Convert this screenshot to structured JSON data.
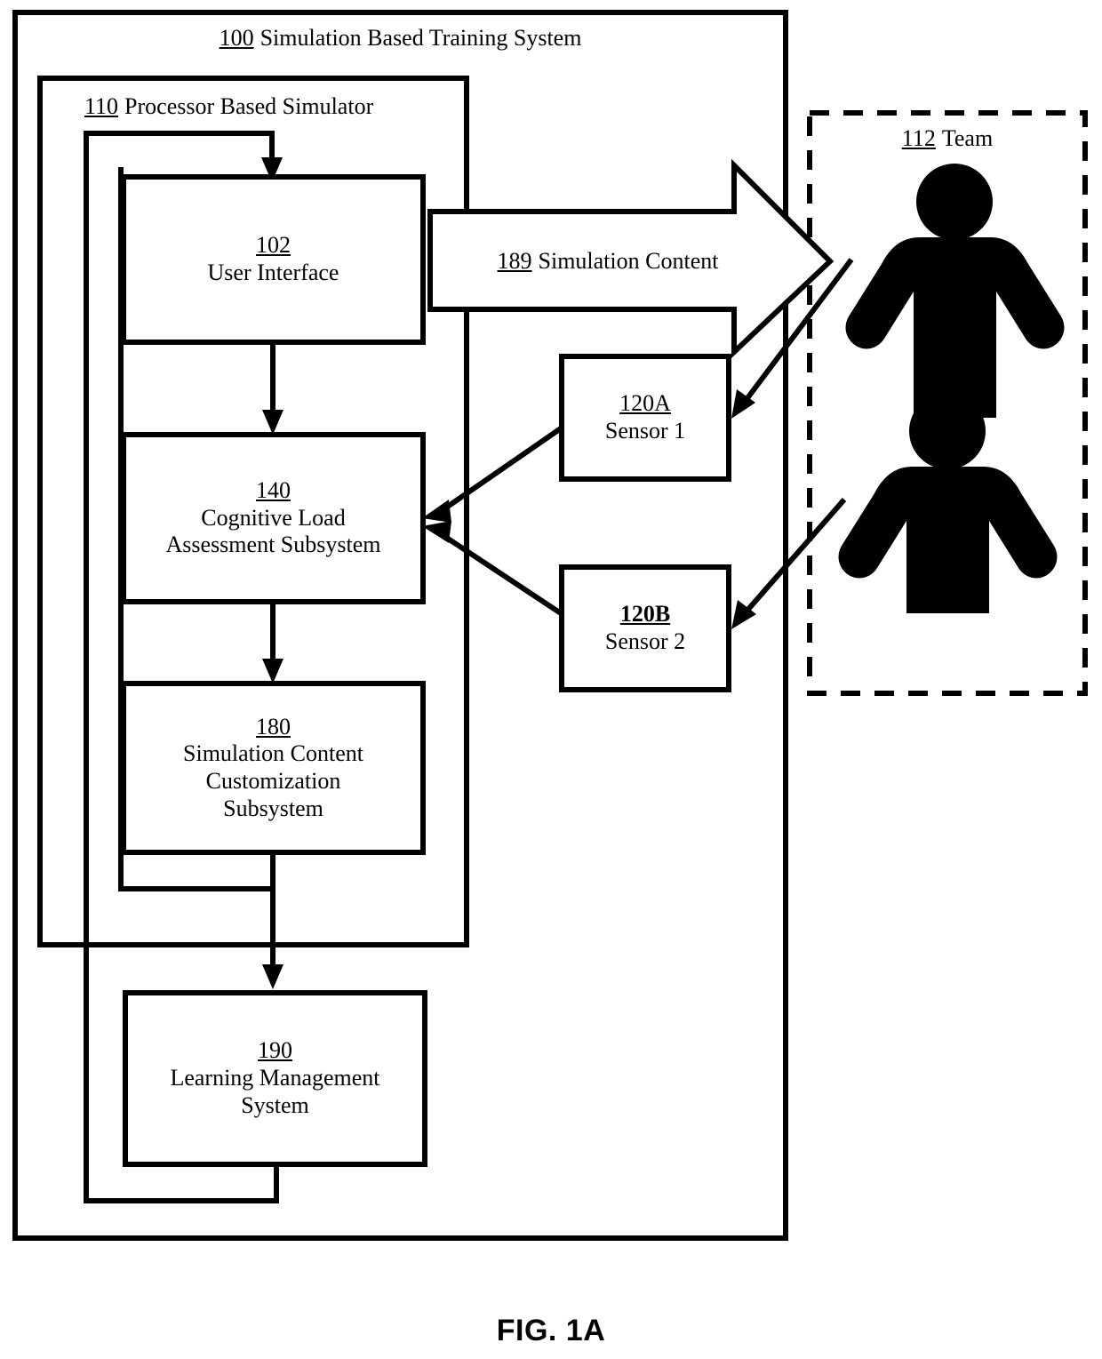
{
  "figure": {
    "caption": "FIG. 1A",
    "title_ref": "100",
    "title_text": " Simulation Based Training System"
  },
  "outer_system": {
    "ref": "100",
    "label": "Simulation Based Training System"
  },
  "simulator": {
    "ref": "110",
    "label": "Processor Based Simulator"
  },
  "team": {
    "ref": "112",
    "label": "Team",
    "members": [
      {
        "name": "team-member-1"
      },
      {
        "name": "team-member-2"
      }
    ]
  },
  "blocks": [
    {
      "id": "user-interface",
      "ref": "102",
      "lines": [
        "User Interface"
      ]
    },
    {
      "id": "cognitive-load-assessment-subsystem",
      "ref": "140",
      "lines": [
        "Cognitive Load",
        "Assessment Subsystem"
      ]
    },
    {
      "id": "simulation-content-customization-subsystem",
      "ref": "180",
      "lines": [
        "Simulation Content",
        "Customization",
        "Subsystem"
      ]
    },
    {
      "id": "learning-management-system",
      "ref": "190",
      "lines": [
        "Learning Management",
        "System"
      ]
    },
    {
      "id": "sensor-1",
      "ref": "120A",
      "lines": [
        "Sensor 1"
      ]
    },
    {
      "id": "sensor-2",
      "ref": "120B",
      "lines": [
        "Sensor 2"
      ]
    }
  ],
  "flow_arrow": {
    "ref": "189",
    "label": "Simulation Content"
  },
  "colors": {
    "stroke": "#000000",
    "fill": "#ffffff",
    "figure_fill": "#000000"
  }
}
